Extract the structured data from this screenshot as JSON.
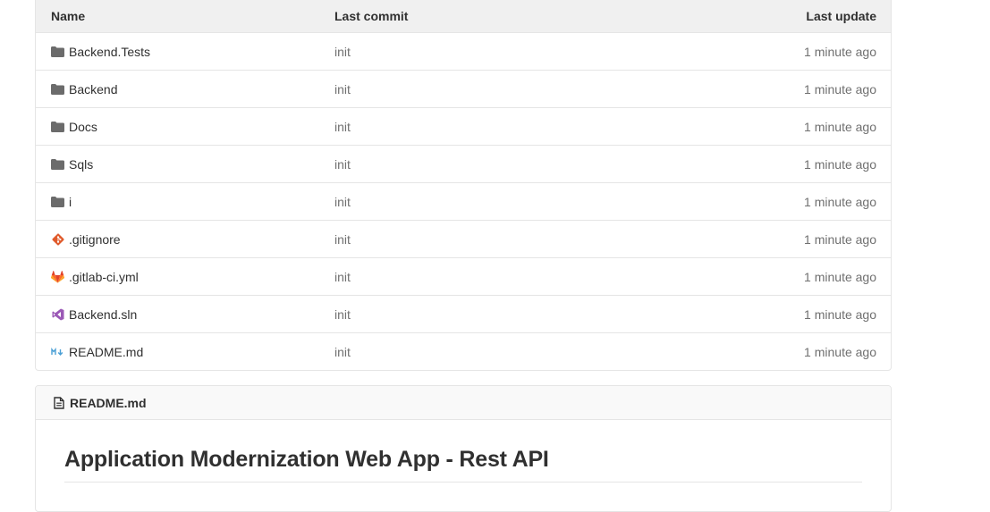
{
  "tree": {
    "headers": {
      "name": "Name",
      "last_commit": "Last commit",
      "last_update": "Last update"
    },
    "rows": [
      {
        "name": "Backend.Tests",
        "icon": "folder-icon",
        "commit": "init",
        "updated": "1 minute ago"
      },
      {
        "name": "Backend",
        "icon": "folder-icon",
        "commit": "init",
        "updated": "1 minute ago"
      },
      {
        "name": "Docs",
        "icon": "folder-icon",
        "commit": "init",
        "updated": "1 minute ago"
      },
      {
        "name": "Sqls",
        "icon": "folder-icon",
        "commit": "init",
        "updated": "1 minute ago"
      },
      {
        "name": "i",
        "icon": "folder-icon",
        "commit": "init",
        "updated": "1 minute ago"
      },
      {
        "name": ".gitignore",
        "icon": "git-icon",
        "commit": "init",
        "updated": "1 minute ago"
      },
      {
        "name": ".gitlab-ci.yml",
        "icon": "gitlab-icon",
        "commit": "init",
        "updated": "1 minute ago"
      },
      {
        "name": "Backend.sln",
        "icon": "visual-studio-icon",
        "commit": "init",
        "updated": "1 minute ago"
      },
      {
        "name": "README.md",
        "icon": "markdown-icon",
        "commit": "init",
        "updated": "1 minute ago"
      }
    ]
  },
  "readme": {
    "filename": "README.md",
    "heading": "Application Modernization Web App - Rest API"
  },
  "colors": {
    "folder": "#6b6b6b",
    "git": "#e05a2b",
    "gitlab": "#fc6d26",
    "visual_studio": "#9b59b6",
    "markdown": "#4a9fd5"
  }
}
